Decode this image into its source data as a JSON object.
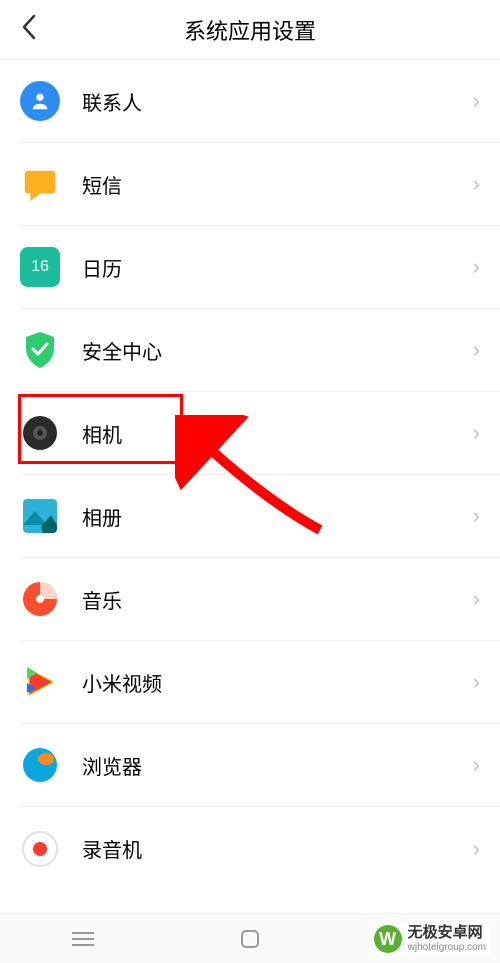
{
  "header": {
    "title": "系统应用设置"
  },
  "items": [
    {
      "id": "contacts",
      "label": "联系人"
    },
    {
      "id": "messages",
      "label": "短信"
    },
    {
      "id": "calendar",
      "label": "日历",
      "badge": "16"
    },
    {
      "id": "security",
      "label": "安全中心"
    },
    {
      "id": "camera",
      "label": "相机"
    },
    {
      "id": "gallery",
      "label": "相册"
    },
    {
      "id": "music",
      "label": "音乐"
    },
    {
      "id": "video",
      "label": "小米视频"
    },
    {
      "id": "browser",
      "label": "浏览器"
    },
    {
      "id": "recorder",
      "label": "录音机"
    }
  ],
  "highlighted_item_index": 4,
  "watermark": {
    "name": "无极安卓网",
    "url": "wjhotelgroup.com"
  }
}
